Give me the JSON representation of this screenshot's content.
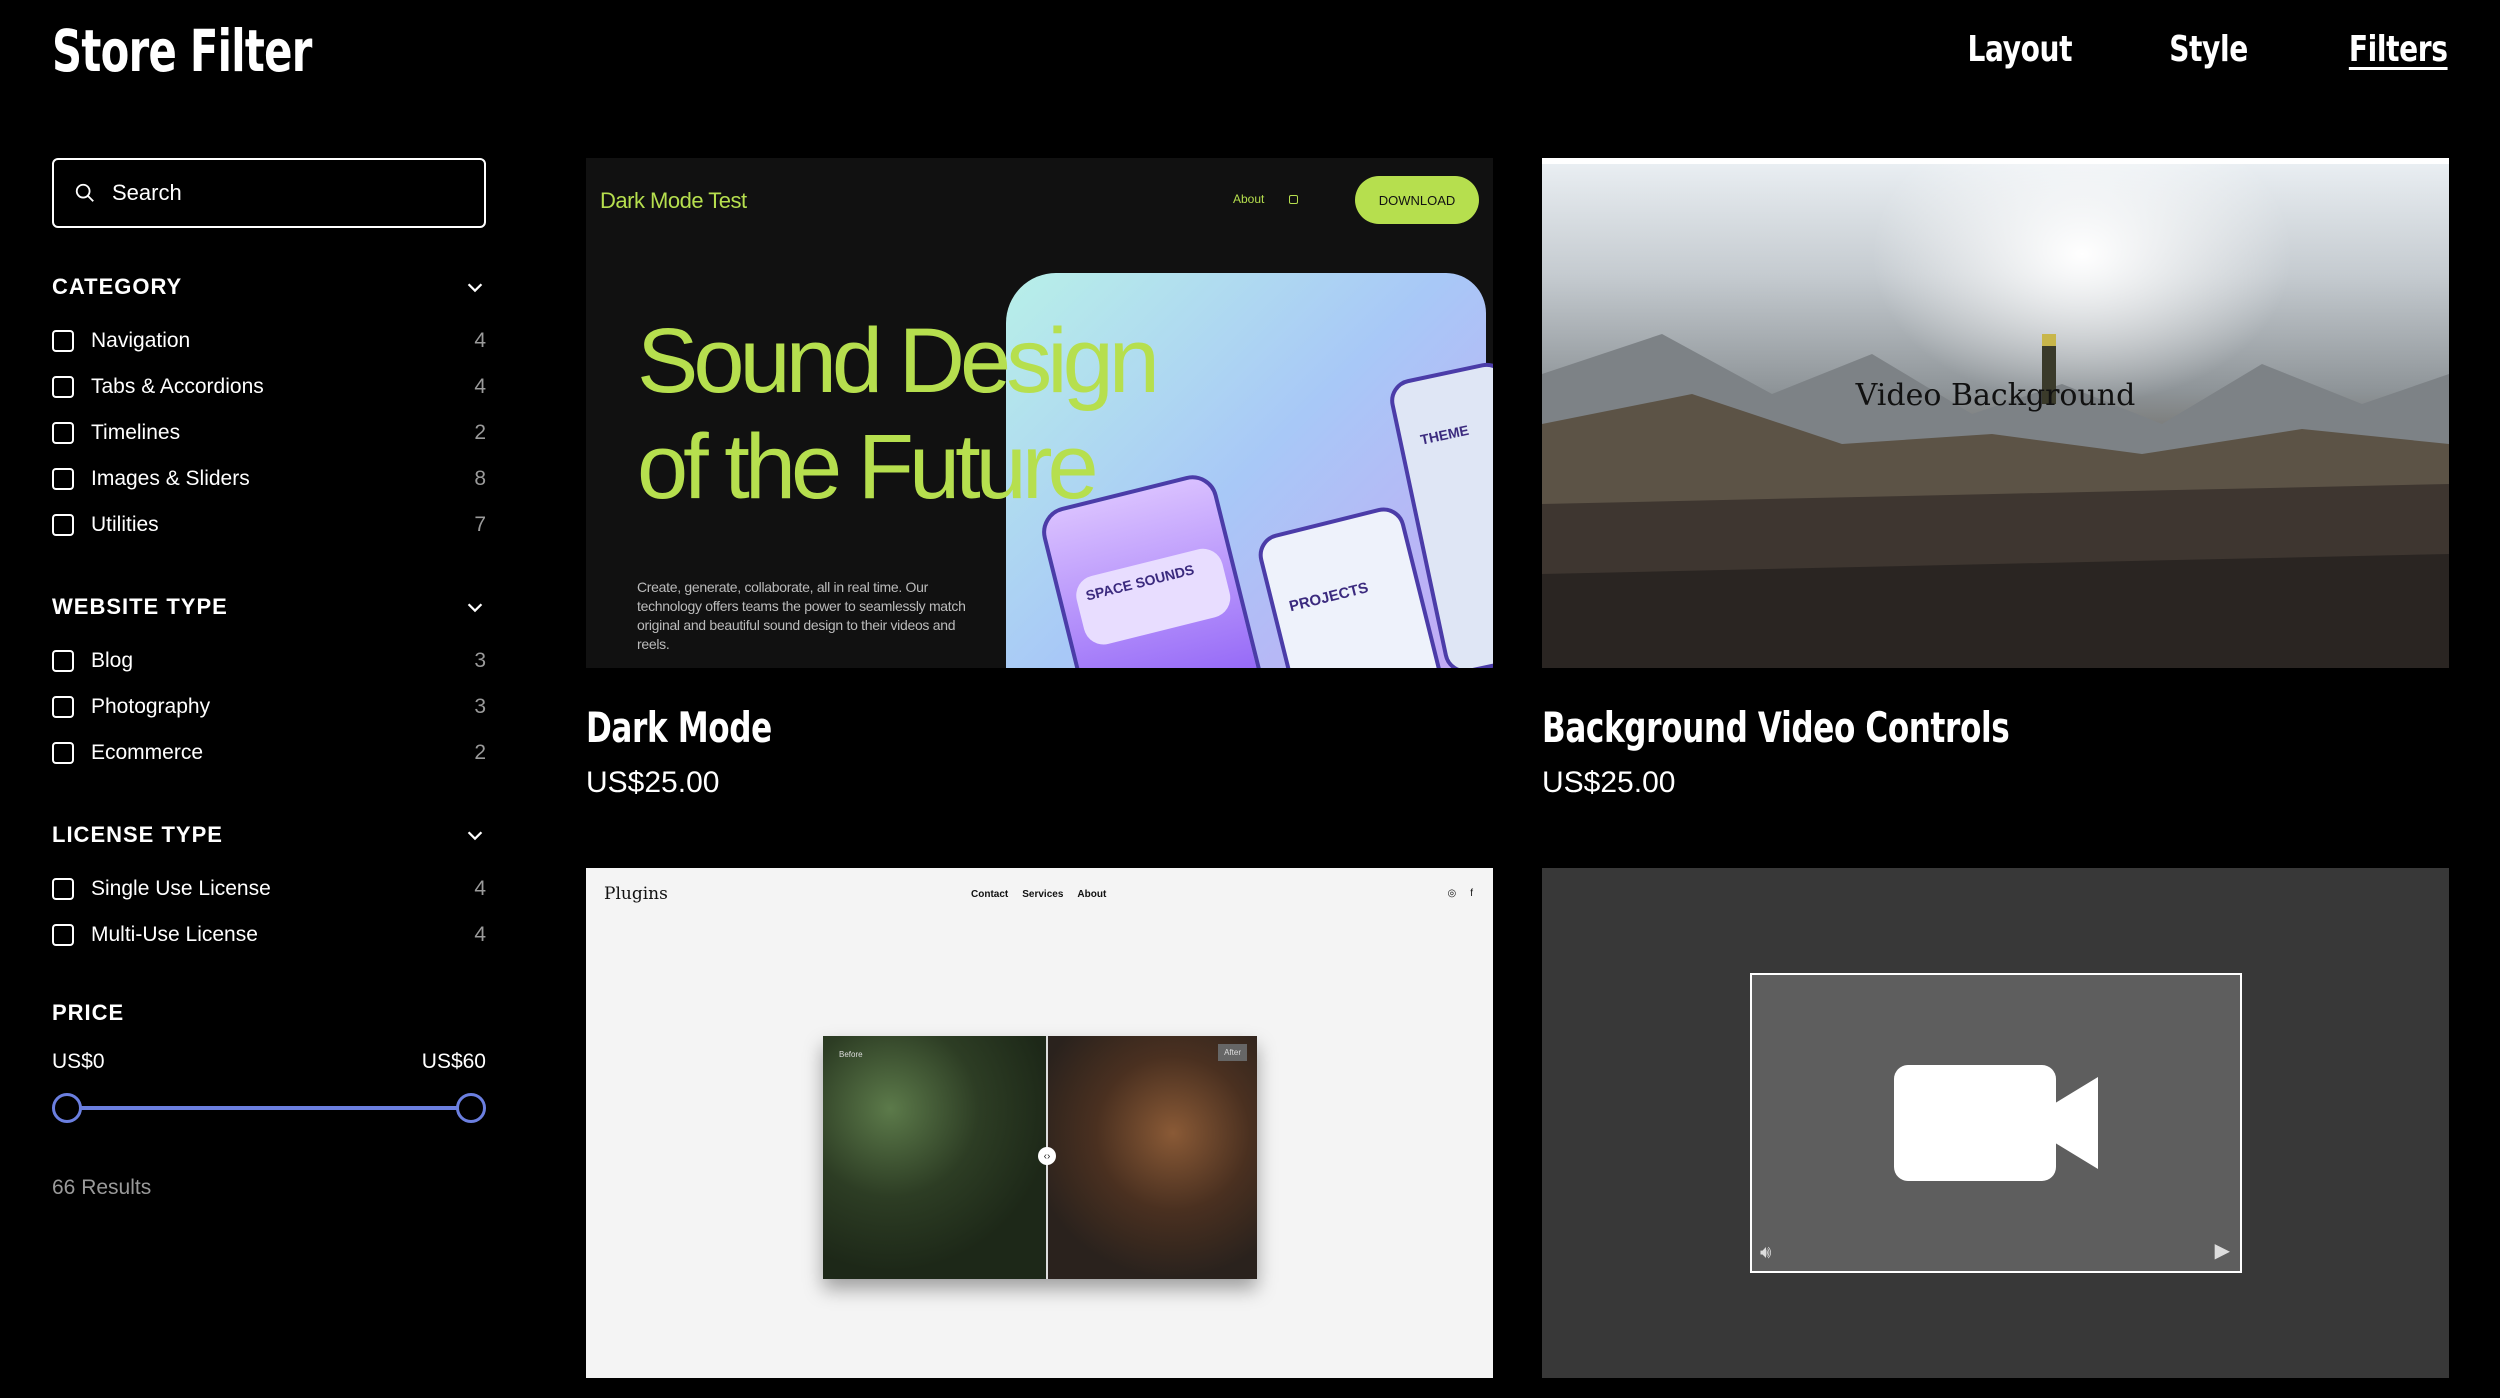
{
  "header": {
    "brand": "Store Filter",
    "nav": [
      "Layout",
      "Style",
      "Filters"
    ]
  },
  "sidebar": {
    "search_placeholder": "Search",
    "sections": [
      {
        "title": "CATEGORY",
        "options": [
          {
            "label": "Navigation",
            "count": "4"
          },
          {
            "label": "Tabs & Accordions",
            "count": "4"
          },
          {
            "label": "Timelines",
            "count": "2"
          },
          {
            "label": "Images & Sliders",
            "count": "8"
          },
          {
            "label": "Utilities",
            "count": "7"
          }
        ]
      },
      {
        "title": "WEBSITE TYPE",
        "options": [
          {
            "label": "Blog",
            "count": "3"
          },
          {
            "label": "Photography",
            "count": "3"
          },
          {
            "label": "Ecommerce",
            "count": "2"
          }
        ]
      },
      {
        "title": "LICENSE TYPE",
        "options": [
          {
            "label": "Single Use License",
            "count": "4"
          },
          {
            "label": "Multi-Use License",
            "count": "4"
          }
        ]
      }
    ],
    "price": {
      "title": "PRICE",
      "min_label": "US$0",
      "max_label": "US$60",
      "min_value": 0,
      "max_value": 60
    },
    "results": "66 Results"
  },
  "products": [
    {
      "title": "Dark Mode",
      "price": "US$25.00",
      "thumb": {
        "logo": "Dark Mode Test",
        "about": "About",
        "button": "DOWNLOAD",
        "headline_1": "Sound Design",
        "headline_2": "of the Future",
        "body": "Create, generate, collaborate, all in real time. Our technology offers teams the power to seamlessly match original and beautiful sound design to their videos and reels.",
        "card_1": "SPACE SOUNDS",
        "card_2": "PROJECTS",
        "card_3": "THEME"
      }
    },
    {
      "title": "Background Video Controls",
      "price": "US$25.00",
      "thumb": {
        "overlay": "Video Background"
      }
    },
    {
      "thumb": {
        "logo": "Plugins",
        "nav": [
          "Contact",
          "Services",
          "About"
        ],
        "before": "Before",
        "after": "After"
      }
    },
    {
      "thumb": {
        "icon": "video-camera-icon"
      }
    }
  ],
  "colors": {
    "accent": "#6b7fe0",
    "lime": "#b6df4e",
    "background": "#000000"
  }
}
